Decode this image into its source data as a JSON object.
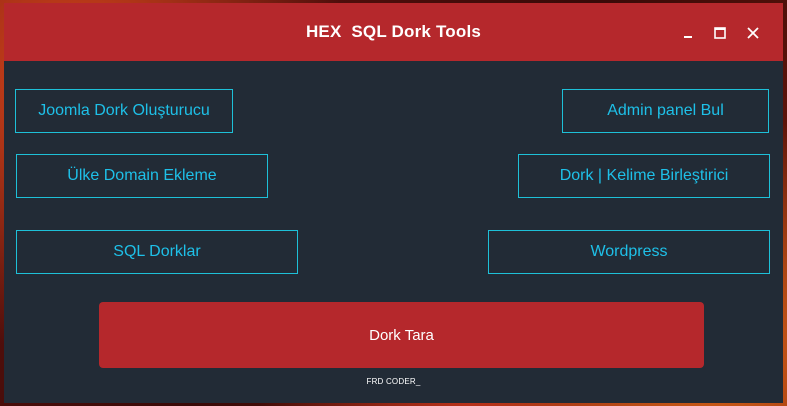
{
  "window": {
    "title": "HEX  SQL Dork Tools",
    "controls": {
      "minimize_icon": "minimize-icon",
      "maximize_icon": "maximize-icon",
      "close_icon": "close-icon"
    }
  },
  "buttons": {
    "joomla": "Joomla Dork Oluşturucu",
    "admin_panel": "Admin panel Bul",
    "country_domain": "Ülke Domain Ekleme",
    "dork_merge": "Dork | Kelime Birleştirici",
    "sql_dorks": "SQL Dorklar",
    "wordpress": "Wordpress",
    "scan": "Dork Tara"
  },
  "footer": {
    "credit": "FRD CODER_"
  },
  "colors": {
    "accent_red": "#b5282c",
    "window_bg": "#222b36",
    "outline_cyan": "#1ec0d8",
    "text_cyan": "#1ec0e8"
  }
}
